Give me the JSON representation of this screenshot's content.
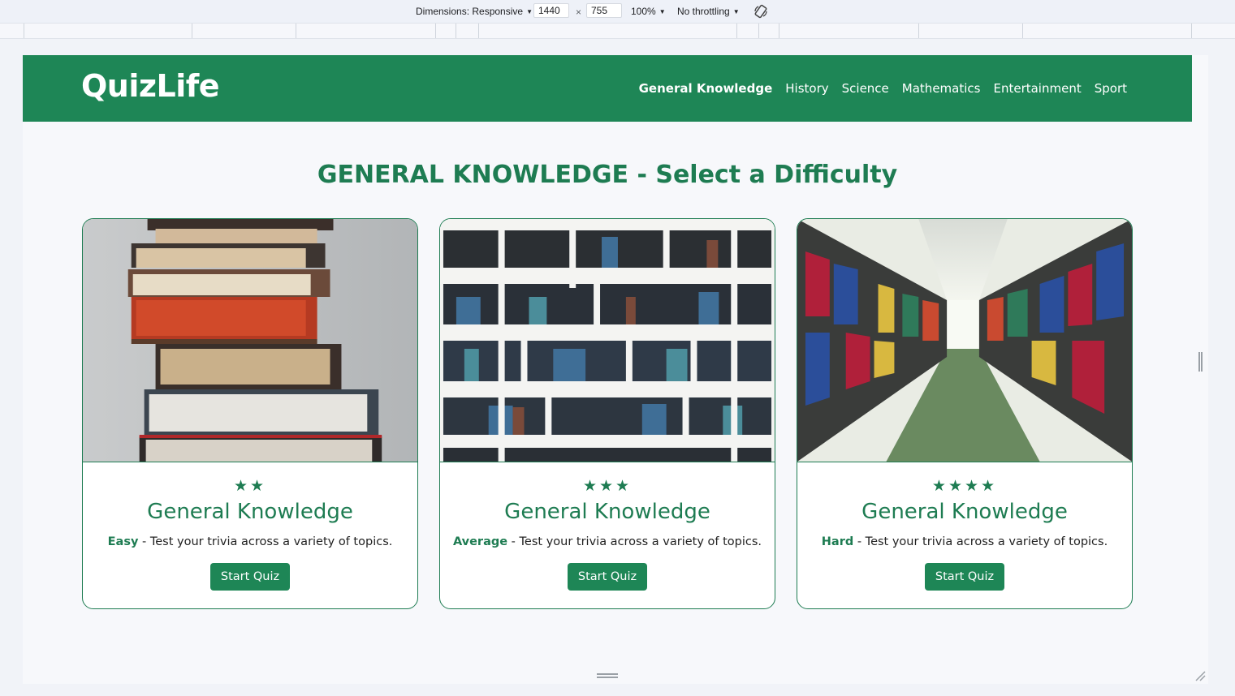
{
  "devtools": {
    "dimensions_label": "Dimensions: Responsive",
    "width": "1440",
    "times": "×",
    "height": "755",
    "zoom": "100%",
    "throttling": "No throttling"
  },
  "site": {
    "logo": "QuizLife",
    "nav": [
      {
        "label": "General Knowledge",
        "active": true
      },
      {
        "label": "History"
      },
      {
        "label": "Science"
      },
      {
        "label": "Mathematics"
      },
      {
        "label": "Entertainment"
      },
      {
        "label": "Sport"
      }
    ],
    "page_title": "GENERAL KNOWLEDGE - Select a Difficulty",
    "cards": [
      {
        "image": "stacked-books",
        "stars": "★★",
        "star_count": 2,
        "title": "General Knowledge",
        "difficulty": "Easy",
        "description": " - Test your trivia across a variety of topics.",
        "button": "Start Quiz"
      },
      {
        "image": "bookshelf",
        "stars": "★★★",
        "star_count": 3,
        "title": "General Knowledge",
        "difficulty": "Average",
        "description": " - Test your trivia across a variety of topics.",
        "button": "Start Quiz"
      },
      {
        "image": "library-aisle",
        "stars": "★★★★",
        "star_count": 4,
        "title": "General Knowledge",
        "difficulty": "Hard",
        "description": " - Test your trivia across a variety of topics.",
        "button": "Start Quiz"
      }
    ]
  },
  "colors": {
    "brand_green": "#1e8656",
    "heading_green": "#1e7c52"
  }
}
